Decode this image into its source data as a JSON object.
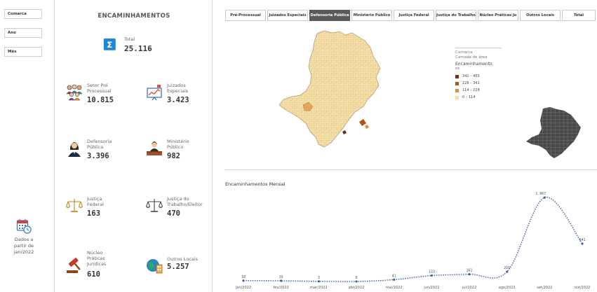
{
  "filters": {
    "comarca_label": "Comarca",
    "ano_label": "Ano",
    "mes_label": "Mês"
  },
  "info": {
    "text": "Dados a partir de jan/2022"
  },
  "kpis": {
    "title": "ENCAMINHAMENTOS",
    "total": {
      "label": "Total",
      "value": "25.116"
    },
    "setor": {
      "label": "Setor Pré\nProcessual",
      "value": "10.815"
    },
    "juizados": {
      "label": "Juizados\nEspeciais",
      "value": "3.423"
    },
    "defensoria": {
      "label": "Defensoria\nPública",
      "value": "3.396"
    },
    "ministerio": {
      "label": "Ministério\nPúblico",
      "value": "982"
    },
    "justica_federal": {
      "label": "Justiça\nFederal",
      "value": "163"
    },
    "justica_trabalho": {
      "label": "Justiça do\nTrabalho/Eleitor",
      "value": "470"
    },
    "nucleo": {
      "label": "Núcleo\nPráticas\nJurídicas",
      "value": "610"
    },
    "outros": {
      "label": "Outros Locais",
      "value": "5.257"
    }
  },
  "tabs": [
    {
      "label": "Pré-Processual",
      "active": false
    },
    {
      "label": "Juizados Especiais",
      "active": false
    },
    {
      "label": "Defensoria Pública",
      "active": true
    },
    {
      "label": "Ministério Público",
      "active": false
    },
    {
      "label": "Justiça Federal",
      "active": false
    },
    {
      "label": "Justiça do Trabalho",
      "active": false
    },
    {
      "label": "Núcleo Práticas Ju",
      "active": false
    },
    {
      "label": "Outros Locais",
      "active": false
    },
    {
      "label": "Total",
      "active": false
    }
  ],
  "map_legend": {
    "layer": "Comarca",
    "sublayer": "Camada de área",
    "measure": "Encaminhamento",
    "measure_suffix": "os",
    "classes": [
      {
        "label": "341 – 455",
        "color": "#7a2a0c"
      },
      {
        "label": "228 – 341",
        "color": "#b4501b"
      },
      {
        "label": "114 – 228",
        "color": "#e38d3c"
      },
      {
        "label": "0 – 114",
        "color": "#f8dd9d"
      }
    ]
  },
  "colors": {
    "map_fill": "#f7e0a6",
    "map_stroke": "#a99468",
    "inset_fill": "#4a4a4a",
    "line": "#3e64a8",
    "icon_blue": "#1e88d4"
  },
  "chart_data": {
    "type": "line",
    "title": "Encaminhamentos Mensal",
    "categories": [
      "jan/2022",
      "fev/2022",
      "mar/2022",
      "abr/2022",
      "mai/2022",
      "jun/2022",
      "jul/2022",
      "ago/2022",
      "set/2022",
      "out/2022"
    ],
    "series": [
      {
        "values": [
          18,
          16,
          3,
          0,
          41,
          133,
          161,
          216,
          1867,
          841
        ]
      }
    ],
    "data_labels": [
      "18",
      "16",
      "3",
      "0",
      "41",
      "133",
      "161",
      "216",
      "1.867",
      "841"
    ],
    "ylim": [
      0,
      1900
    ],
    "grid": false,
    "legend": "none"
  }
}
